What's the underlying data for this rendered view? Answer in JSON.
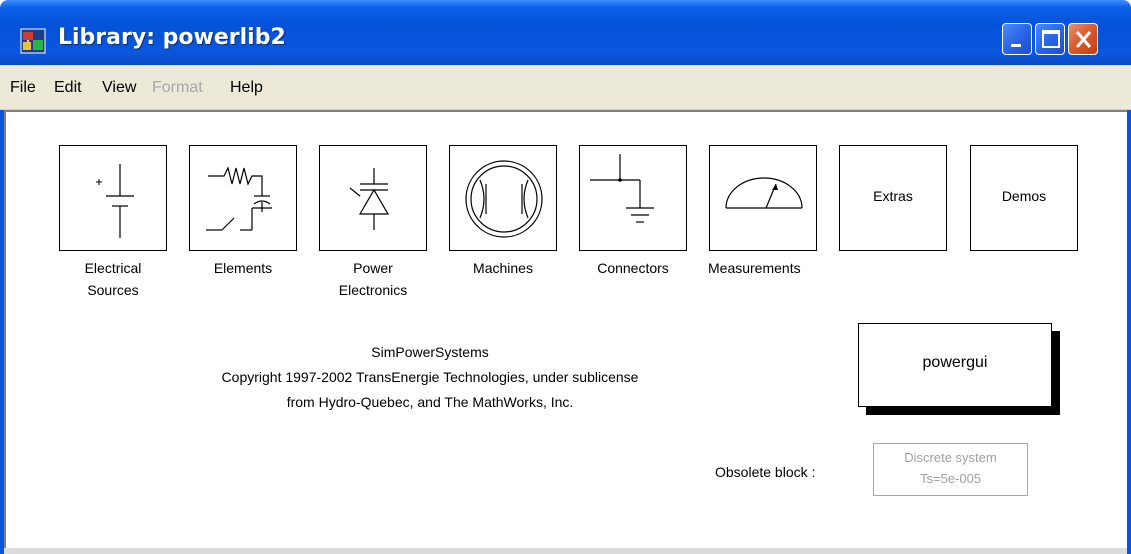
{
  "window": {
    "title": "Library: powerlib2"
  },
  "menu": {
    "items": [
      {
        "label": "File",
        "enabled": true
      },
      {
        "label": "Edit",
        "enabled": true
      },
      {
        "label": "View",
        "enabled": true
      },
      {
        "label": "Format",
        "enabled": false
      },
      {
        "label": "Help",
        "enabled": true
      }
    ]
  },
  "blocks": [
    {
      "name": "electrical-sources",
      "label_lines": [
        "Electrical",
        "Sources"
      ],
      "icon": "dc-source-icon"
    },
    {
      "name": "elements",
      "label_lines": [
        "Elements"
      ],
      "icon": "rlc-elements-icon"
    },
    {
      "name": "power-electronics",
      "label_lines": [
        "Power",
        "Electronics"
      ],
      "icon": "thyristor-icon"
    },
    {
      "name": "machines",
      "label_lines": [
        "Machines"
      ],
      "icon": "machine-icon"
    },
    {
      "name": "connectors",
      "label_lines": [
        "Connectors"
      ],
      "icon": "ground-connector-icon"
    },
    {
      "name": "measurements",
      "label_lines": [
        "Measurements"
      ],
      "icon": "meter-gauge-icon"
    },
    {
      "name": "extras",
      "text": "Extras"
    },
    {
      "name": "demos",
      "text": "Demos"
    }
  ],
  "copyright": {
    "line1": "SimPowerSystems",
    "line2": "Copyright  1997-2002 TransEnergie Technologies, under sublicense",
    "line3": "from Hydro-Quebec, and The MathWorks, Inc."
  },
  "powergui": {
    "label": "powergui"
  },
  "obsolete": {
    "label": "Obsolete block :",
    "block_line1": "Discrete system",
    "block_line2": "Ts=5e-005"
  },
  "colors": {
    "titlebar": "#0a54dc",
    "menubar": "#ece9d8",
    "close_button": "#d9592b",
    "disabled_text": "#a7a6aa"
  }
}
